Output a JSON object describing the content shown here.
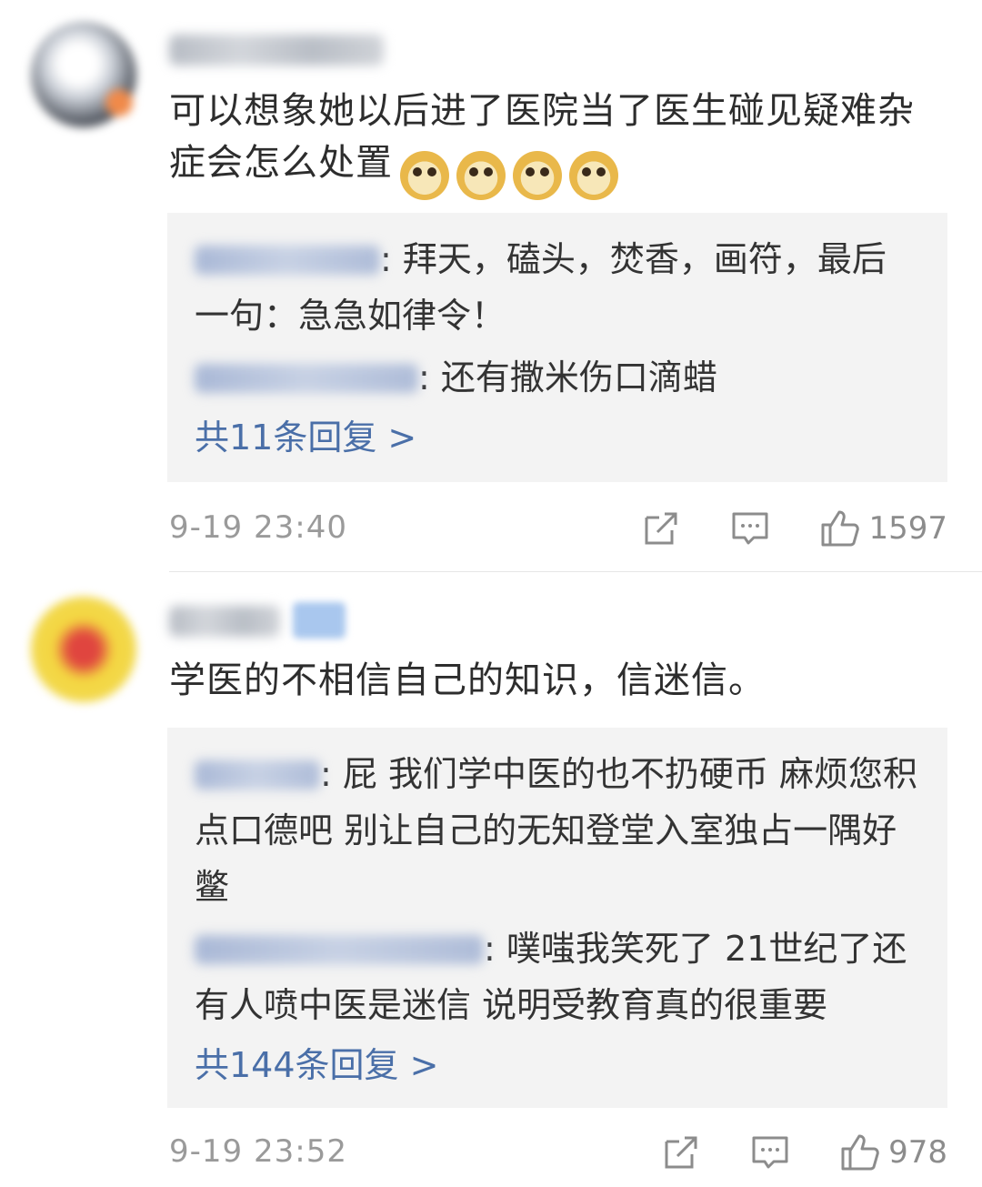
{
  "comments": [
    {
      "text": "可以想象她以后进了医院当了医生碰见疑难杂症会怎么处置",
      "emoji_count": 4,
      "replies": [
        {
          "text": ": 拜天，磕头，焚香，画符，最后一句：急急如律令！"
        },
        {
          "text": ": 还有撒米伤口滴蜡"
        }
      ],
      "more_link": "共11条回复 >",
      "timestamp": "9-19 23:40",
      "like_count": "1597"
    },
    {
      "text": "学医的不相信自己的知识，信迷信。",
      "replies": [
        {
          "text": ": 屁 我们学中医的也不扔硬币 麻烦您积点口德吧 别让自己的无知登堂入室独占一隅好鳖"
        },
        {
          "text": ": 噗嗤我笑死了 21世纪了还有人喷中医是迷信  说明受教育真的很重要"
        }
      ],
      "more_link": "共144条回复 >",
      "timestamp": "9-19 23:52",
      "like_count": "978"
    }
  ],
  "icons": {
    "share": "share-icon",
    "comment": "comment-icon",
    "like": "thumbs-up-icon"
  },
  "colors": {
    "link": "#4a6fa8",
    "reply_bg": "#f3f3f3",
    "meta_text": "#9a9a9a"
  }
}
